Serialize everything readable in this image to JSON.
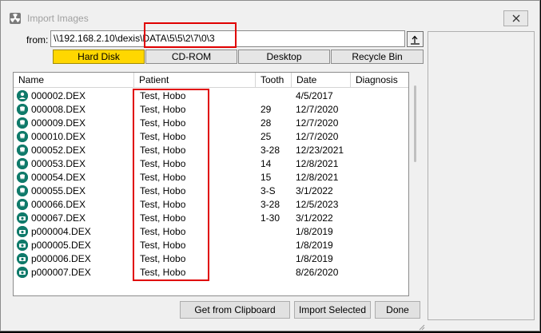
{
  "window": {
    "title": "Import Images"
  },
  "from": {
    "label": "from:",
    "path": "\\\\192.168.2.10\\dexis\\DATA\\5\\5\\2\\7\\0\\3"
  },
  "locations": [
    {
      "label": "Hard Disk",
      "active": true
    },
    {
      "label": "CD-ROM",
      "active": false
    },
    {
      "label": "Desktop",
      "active": false
    },
    {
      "label": "Recycle Bin",
      "active": false
    }
  ],
  "columns": {
    "name": "Name",
    "patient": "Patient",
    "tooth": "Tooth",
    "date": "Date",
    "diagnosis": "Diagnosis"
  },
  "files": [
    {
      "name": "000002.DEX",
      "patient": "Test, Hobo",
      "tooth": "",
      "date": "4/5/2017",
      "icon": "face-photo-icon"
    },
    {
      "name": "000008.DEX",
      "patient": "Test, Hobo",
      "tooth": "29",
      "date": "12/7/2020",
      "icon": "tooth-xray-icon"
    },
    {
      "name": "000009.DEX",
      "patient": "Test, Hobo",
      "tooth": "28",
      "date": "12/7/2020",
      "icon": "tooth-xray-icon"
    },
    {
      "name": "000010.DEX",
      "patient": "Test, Hobo",
      "tooth": "25",
      "date": "12/7/2020",
      "icon": "tooth-xray-icon"
    },
    {
      "name": "000052.DEX",
      "patient": "Test, Hobo",
      "tooth": "3-28",
      "date": "12/23/2021",
      "icon": "tooth-xray-icon"
    },
    {
      "name": "000053.DEX",
      "patient": "Test, Hobo",
      "tooth": "14",
      "date": "12/8/2021",
      "icon": "tooth-xray-icon"
    },
    {
      "name": "000054.DEX",
      "patient": "Test, Hobo",
      "tooth": "15",
      "date": "12/8/2021",
      "icon": "tooth-xray-icon"
    },
    {
      "name": "000055.DEX",
      "patient": "Test, Hobo",
      "tooth": "3-S",
      "date": "3/1/2022",
      "icon": "tooth-xray-icon"
    },
    {
      "name": "000066.DEX",
      "patient": "Test, Hobo",
      "tooth": "3-28",
      "date": "12/5/2023",
      "icon": "tooth-xray-icon"
    },
    {
      "name": "000067.DEX",
      "patient": "Test, Hobo",
      "tooth": "1-30",
      "date": "3/1/2022",
      "icon": "camera-icon"
    },
    {
      "name": "p000004.DEX",
      "patient": "Test, Hobo",
      "tooth": "",
      "date": "1/8/2019",
      "icon": "camera-icon"
    },
    {
      "name": "p000005.DEX",
      "patient": "Test, Hobo",
      "tooth": "",
      "date": "1/8/2019",
      "icon": "camera-icon"
    },
    {
      "name": "p000006.DEX",
      "patient": "Test, Hobo",
      "tooth": "",
      "date": "1/8/2019",
      "icon": "camera-icon"
    },
    {
      "name": "p000007.DEX",
      "patient": "Test, Hobo",
      "tooth": "",
      "date": "8/26/2020",
      "icon": "camera-icon"
    }
  ],
  "buttons": {
    "clipboard": "Get from Clipboard",
    "import": "Import Selected",
    "done": "Done"
  },
  "colors": {
    "active_location": "#ffd700",
    "annotation": "#e00000",
    "icon_teal": "#0f7a6a"
  }
}
